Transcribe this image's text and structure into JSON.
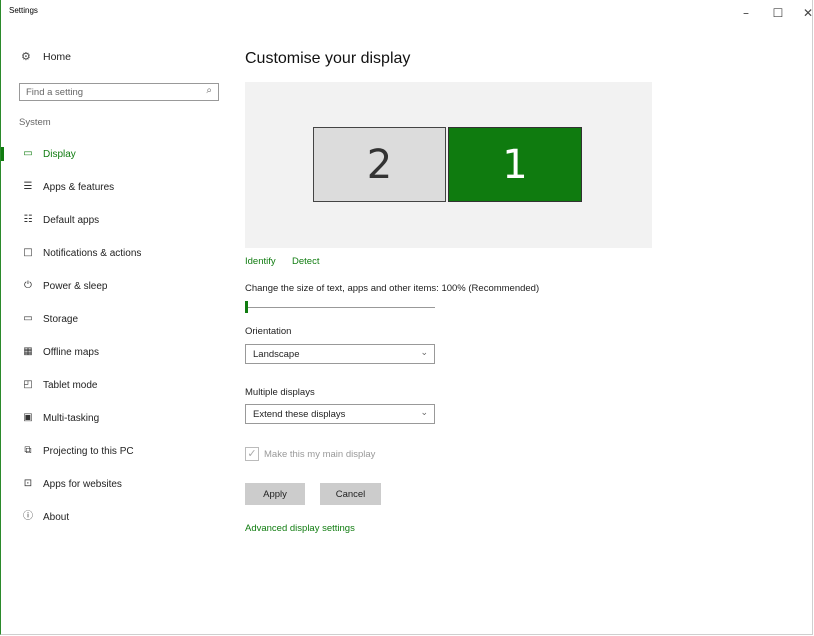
{
  "window": {
    "title": "Settings",
    "controls": {
      "minimize": "–",
      "maximize": "☐",
      "close": "✕"
    }
  },
  "sidebar": {
    "home_label": "Home",
    "home_icon": "gear-icon",
    "search_placeholder": "Find a setting",
    "section_label": "System",
    "items": [
      {
        "label": "Display",
        "icon": "display-icon",
        "active": true
      },
      {
        "label": "Apps & features",
        "icon": "apps-features-icon"
      },
      {
        "label": "Default apps",
        "icon": "default-apps-icon"
      },
      {
        "label": "Notifications & actions",
        "icon": "notifications-icon"
      },
      {
        "label": "Power & sleep",
        "icon": "power-icon"
      },
      {
        "label": "Storage",
        "icon": "storage-icon"
      },
      {
        "label": "Offline maps",
        "icon": "map-icon"
      },
      {
        "label": "Tablet mode",
        "icon": "tablet-icon"
      },
      {
        "label": "Multi-tasking",
        "icon": "multitasking-icon"
      },
      {
        "label": "Projecting to this PC",
        "icon": "projecting-icon"
      },
      {
        "label": "Apps for websites",
        "icon": "apps-websites-icon"
      },
      {
        "label": "About",
        "icon": "info-icon"
      }
    ]
  },
  "main": {
    "heading": "Customise your display",
    "monitors": [
      {
        "number": "2",
        "selected": false
      },
      {
        "number": "1",
        "selected": true
      }
    ],
    "identify_label": "Identify",
    "detect_label": "Detect",
    "scale_label": "Change the size of text, apps and other items: 100% (Recommended)",
    "scale_level": 0,
    "orientation_label": "Orientation",
    "orientation_value": "Landscape",
    "multiple_displays_label": "Multiple displays",
    "multiple_displays_value": "Extend these displays",
    "main_display_label": "Make this my main display",
    "main_display_checked": true,
    "main_display_enabled": false,
    "apply_label": "Apply",
    "cancel_label": "Cancel",
    "advanced_link": "Advanced display settings"
  },
  "colors": {
    "accent": "#107c10",
    "selected_monitor": "#0f7b0f",
    "unselected_monitor": "#dcdcdc",
    "button": "#cccccc"
  }
}
